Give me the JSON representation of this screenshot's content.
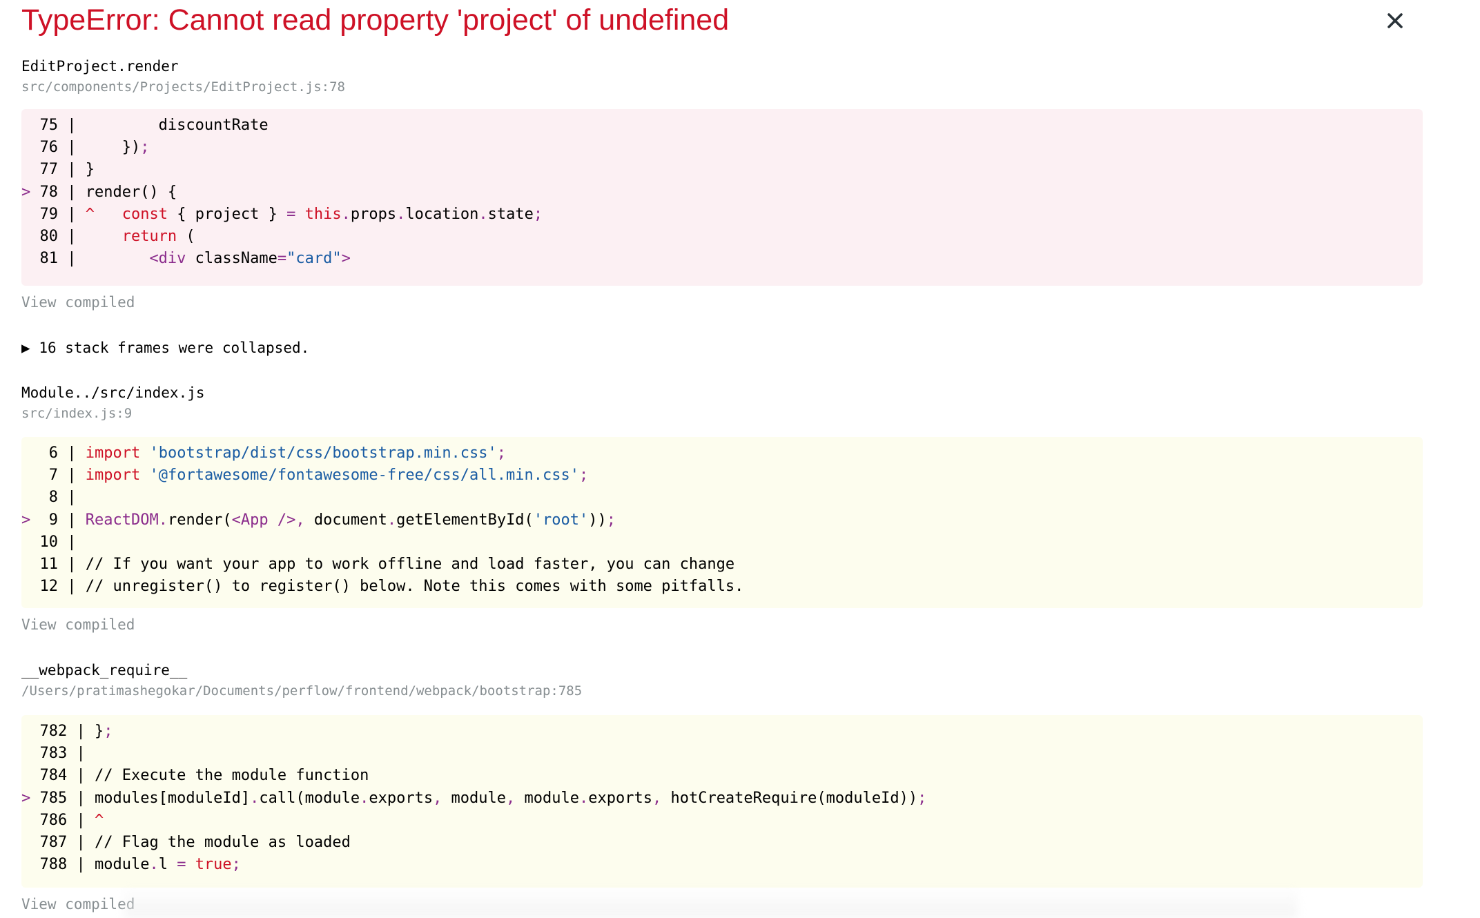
{
  "error": {
    "title": "TypeError: Cannot read property 'project' of undefined",
    "close_icon": "close-icon"
  },
  "frames": [
    {
      "name": "EditProject.render",
      "file": "src/components/Projects/EditProject.js:78",
      "view_compiled": "View compiled"
    },
    {
      "name": "Module../src/index.js",
      "file": "src/index.js:9",
      "view_compiled": "View compiled"
    },
    {
      "name": "__webpack_require__",
      "file": "/Users/pratimashegokar/Documents/perflow/frontend/webpack/bootstrap:785",
      "view_compiled": "View compiled"
    }
  ],
  "collapsed": {
    "arrow": "▶",
    "text": "16 stack frames were collapsed."
  },
  "code_blocks": [
    {
      "style": "error",
      "lines": [
        {
          "marker": " ",
          "num": "75",
          "code": "        discountRate"
        },
        {
          "marker": " ",
          "num": "76",
          "code": "    });"
        },
        {
          "marker": " ",
          "num": "77",
          "code": "}"
        },
        {
          "marker": ">",
          "num": "78",
          "code": "render() {"
        },
        {
          "marker": " ",
          "num": "79",
          "code": "^   const { project } = this.props.location.state;"
        },
        {
          "marker": " ",
          "num": "80",
          "code": "    return ("
        },
        {
          "marker": " ",
          "num": "81",
          "code": "       <div className=\"card\">"
        }
      ]
    },
    {
      "style": "warn",
      "lines": [
        {
          "marker": " ",
          "num": "6",
          "code": "import 'bootstrap/dist/css/bootstrap.min.css';"
        },
        {
          "marker": " ",
          "num": "7",
          "code": "import '@fortawesome/fontawesome-free/css/all.min.css';"
        },
        {
          "marker": " ",
          "num": "8",
          "code": ""
        },
        {
          "marker": ">",
          "num": "9",
          "code": "ReactDOM.render(<App />, document.getElementById('root'));"
        },
        {
          "marker": " ",
          "num": "10",
          "code": ""
        },
        {
          "marker": " ",
          "num": "11",
          "code": "// If you want your app to work offline and load faster, you can change"
        },
        {
          "marker": " ",
          "num": "12",
          "code": "// unregister() to register() below. Note this comes with some pitfalls."
        }
      ]
    },
    {
      "style": "warn",
      "lines": [
        {
          "marker": " ",
          "num": "782",
          "code": "};"
        },
        {
          "marker": " ",
          "num": "783",
          "code": ""
        },
        {
          "marker": " ",
          "num": "784",
          "code": "// Execute the module function"
        },
        {
          "marker": ">",
          "num": "785",
          "code": "modules[moduleId].call(module.exports, module, module.exports, hotCreateRequire(moduleId));"
        },
        {
          "marker": " ",
          "num": "786",
          "code": "^"
        },
        {
          "marker": " ",
          "num": "787",
          "code": "// Flag the module as loaded"
        },
        {
          "marker": " ",
          "num": "788",
          "code": "module.l = true;"
        }
      ]
    }
  ]
}
